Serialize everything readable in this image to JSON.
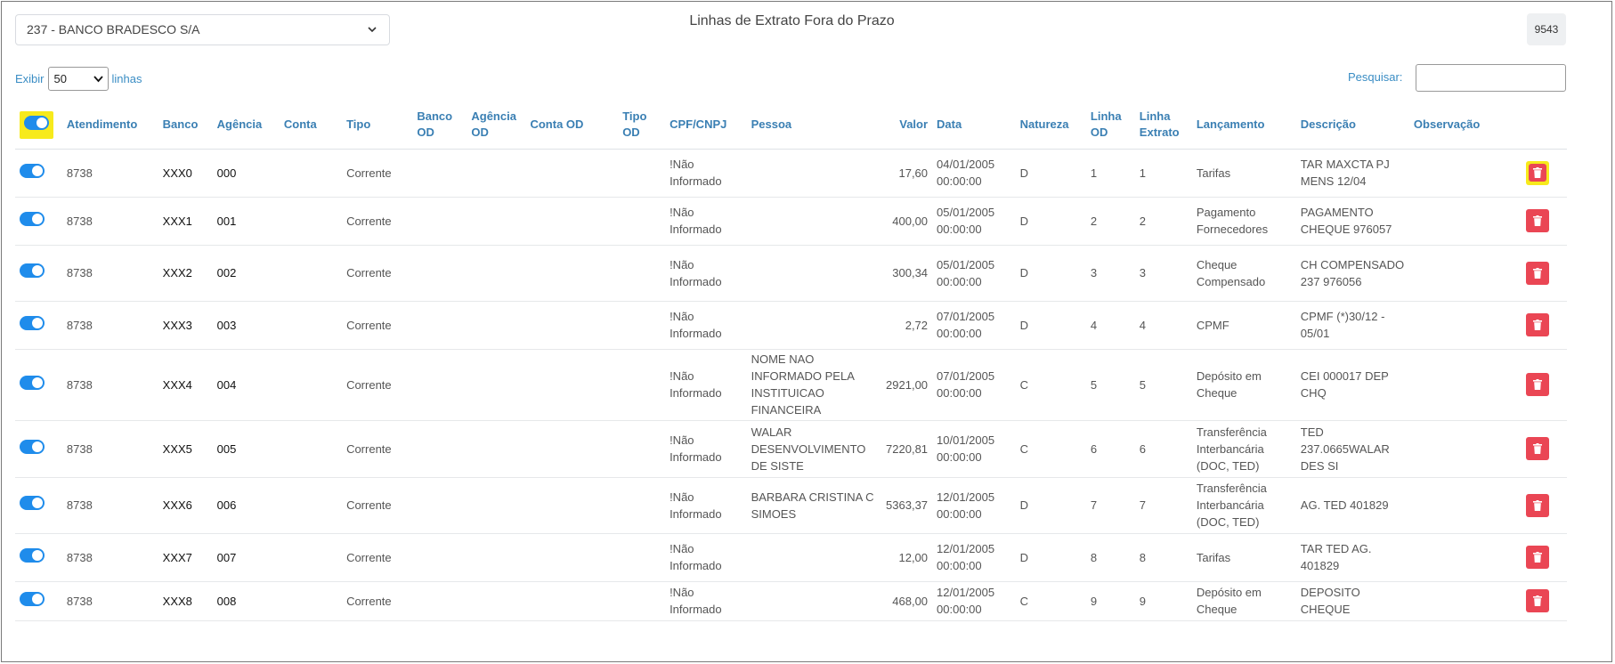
{
  "bank_select": {
    "value": "237 - BANCO BRADESCO S/A"
  },
  "title": "Linhas de Extrato Fora do Prazo",
  "count": "9543",
  "pagination": {
    "prefix": "Exibir",
    "page_size": "50",
    "suffix": "linhas"
  },
  "search": {
    "label": "Pesquisar:",
    "value": ""
  },
  "colors": {
    "toggle": "#1f8ceb",
    "delete": "#ea4654",
    "highlight": "#f7ea1c",
    "header": "#3a7fb3"
  },
  "table": {
    "headers": [
      "Atendimento",
      "Banco",
      "Agência",
      "Conta",
      "Tipo",
      "Banco OD",
      "Agência OD",
      "Conta OD",
      "Tipo OD",
      "CPF/CNPJ",
      "Pessoa",
      "Valor",
      "Data",
      "Natureza",
      "Linha OD",
      "Linha Extrato",
      "Lançamento",
      "Descrição",
      "Observação"
    ],
    "rows": [
      {
        "atendimento": "8738",
        "banco": "XXX0",
        "agencia": "000",
        "conta": "",
        "tipo": "Corrente",
        "banco_od": "",
        "agencia_od": "",
        "conta_od": "",
        "tipo_od": "",
        "cpf": "!Não Informado",
        "pessoa": "",
        "valor": "17,60",
        "data": "04/01/2005 00:00:00",
        "natureza": "D",
        "linha_od": "1",
        "linha_extrato": "1",
        "lancamento": "Tarifas",
        "descricao": "TAR MAXCTA PJ MENS 12/04",
        "observacao": ""
      },
      {
        "atendimento": "8738",
        "banco": "XXX1",
        "agencia": "001",
        "conta": "",
        "tipo": "Corrente",
        "banco_od": "",
        "agencia_od": "",
        "conta_od": "",
        "tipo_od": "",
        "cpf": "!Não Informado",
        "pessoa": "",
        "valor": "400,00",
        "data": "05/01/2005 00:00:00",
        "natureza": "D",
        "linha_od": "2",
        "linha_extrato": "2",
        "lancamento": "Pagamento Fornecedores",
        "descricao": "PAGAMENTO CHEQUE 976057",
        "observacao": ""
      },
      {
        "atendimento": "8738",
        "banco": "XXX2",
        "agencia": "002",
        "conta": "",
        "tipo": "Corrente",
        "banco_od": "",
        "agencia_od": "",
        "conta_od": "",
        "tipo_od": "",
        "cpf": "!Não Informado",
        "pessoa": "",
        "valor": "300,34",
        "data": "05/01/2005 00:00:00",
        "natureza": "D",
        "linha_od": "3",
        "linha_extrato": "3",
        "lancamento": "Cheque Compensado",
        "descricao": "CH COMPENSADO 237 976056",
        "observacao": ""
      },
      {
        "atendimento": "8738",
        "banco": "XXX3",
        "agencia": "003",
        "conta": "",
        "tipo": "Corrente",
        "banco_od": "",
        "agencia_od": "",
        "conta_od": "",
        "tipo_od": "",
        "cpf": "!Não Informado",
        "pessoa": "",
        "valor": "2,72",
        "data": "07/01/2005 00:00:00",
        "natureza": "D",
        "linha_od": "4",
        "linha_extrato": "4",
        "lancamento": "CPMF",
        "descricao": "CPMF (*)30/12 - 05/01",
        "observacao": ""
      },
      {
        "atendimento": "8738",
        "banco": "XXX4",
        "agencia": "004",
        "conta": "",
        "tipo": "Corrente",
        "banco_od": "",
        "agencia_od": "",
        "conta_od": "",
        "tipo_od": "",
        "cpf": "!Não Informado",
        "pessoa": "NOME NAO INFORMADO PELA INSTITUICAO FINANCEIRA",
        "valor": "2921,00",
        "data": "07/01/2005 00:00:00",
        "natureza": "C",
        "linha_od": "5",
        "linha_extrato": "5",
        "lancamento": "Depósito em Cheque",
        "descricao": "CEI 000017 DEP CHQ",
        "observacao": ""
      },
      {
        "atendimento": "8738",
        "banco": "XXX5",
        "agencia": "005",
        "conta": "",
        "tipo": "Corrente",
        "banco_od": "",
        "agencia_od": "",
        "conta_od": "",
        "tipo_od": "",
        "cpf": "!Não Informado",
        "pessoa": "WALAR DESENVOLVIMENTO DE SISTE",
        "valor": "7220,81",
        "data": "10/01/2005 00:00:00",
        "natureza": "C",
        "linha_od": "6",
        "linha_extrato": "6",
        "lancamento": "Transferência Interbancária (DOC, TED)",
        "descricao": "TED 237.0665WALAR DES SI",
        "observacao": ""
      },
      {
        "atendimento": "8738",
        "banco": "XXX6",
        "agencia": "006",
        "conta": "",
        "tipo": "Corrente",
        "banco_od": "",
        "agencia_od": "",
        "conta_od": "",
        "tipo_od": "",
        "cpf": "!Não Informado",
        "pessoa": "BARBARA CRISTINA C SIMOES",
        "valor": "5363,37",
        "data": "12/01/2005 00:00:00",
        "natureza": "D",
        "linha_od": "7",
        "linha_extrato": "7",
        "lancamento": "Transferência Interbancária (DOC, TED)",
        "descricao": "AG. TED 401829",
        "observacao": ""
      },
      {
        "atendimento": "8738",
        "banco": "XXX7",
        "agencia": "007",
        "conta": "",
        "tipo": "Corrente",
        "banco_od": "",
        "agencia_od": "",
        "conta_od": "",
        "tipo_od": "",
        "cpf": "!Não Informado",
        "pessoa": "",
        "valor": "12,00",
        "data": "12/01/2005 00:00:00",
        "natureza": "D",
        "linha_od": "8",
        "linha_extrato": "8",
        "lancamento": "Tarifas",
        "descricao": "TAR TED AG. 401829",
        "observacao": ""
      },
      {
        "atendimento": "8738",
        "banco": "XXX8",
        "agencia": "008",
        "conta": "",
        "tipo": "Corrente",
        "banco_od": "",
        "agencia_od": "",
        "conta_od": "",
        "tipo_od": "",
        "cpf": "!Não Informado",
        "pessoa": "",
        "valor": "468,00",
        "data": "12/01/2005 00:00:00",
        "natureza": "C",
        "linha_od": "9",
        "linha_extrato": "9",
        "lancamento": "Depósito em Cheque",
        "descricao": "DEPOSITO CHEQUE",
        "observacao": ""
      }
    ]
  }
}
